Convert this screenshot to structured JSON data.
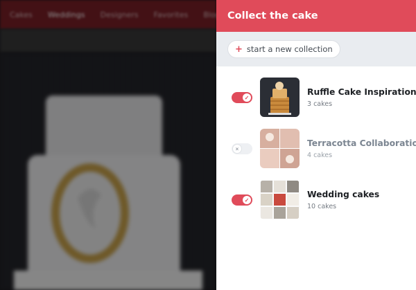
{
  "background_page": {
    "nav_items": [
      "Cakes",
      "Weddings",
      "Designers",
      "Favorites",
      "Blog"
    ],
    "active_nav_index": 1
  },
  "panel": {
    "title": "Collect the cake",
    "new_collection_label": "start a new collection",
    "accent_color": "#e04b5a",
    "collections": [
      {
        "name": "Ruffle Cake Inspiration",
        "count": "3 cakes",
        "selected": true
      },
      {
        "name": "Terracotta Collaboration",
        "count": "4 cakes",
        "selected": false
      },
      {
        "name": "Wedding cakes",
        "count": "10 cakes",
        "selected": true
      }
    ]
  }
}
